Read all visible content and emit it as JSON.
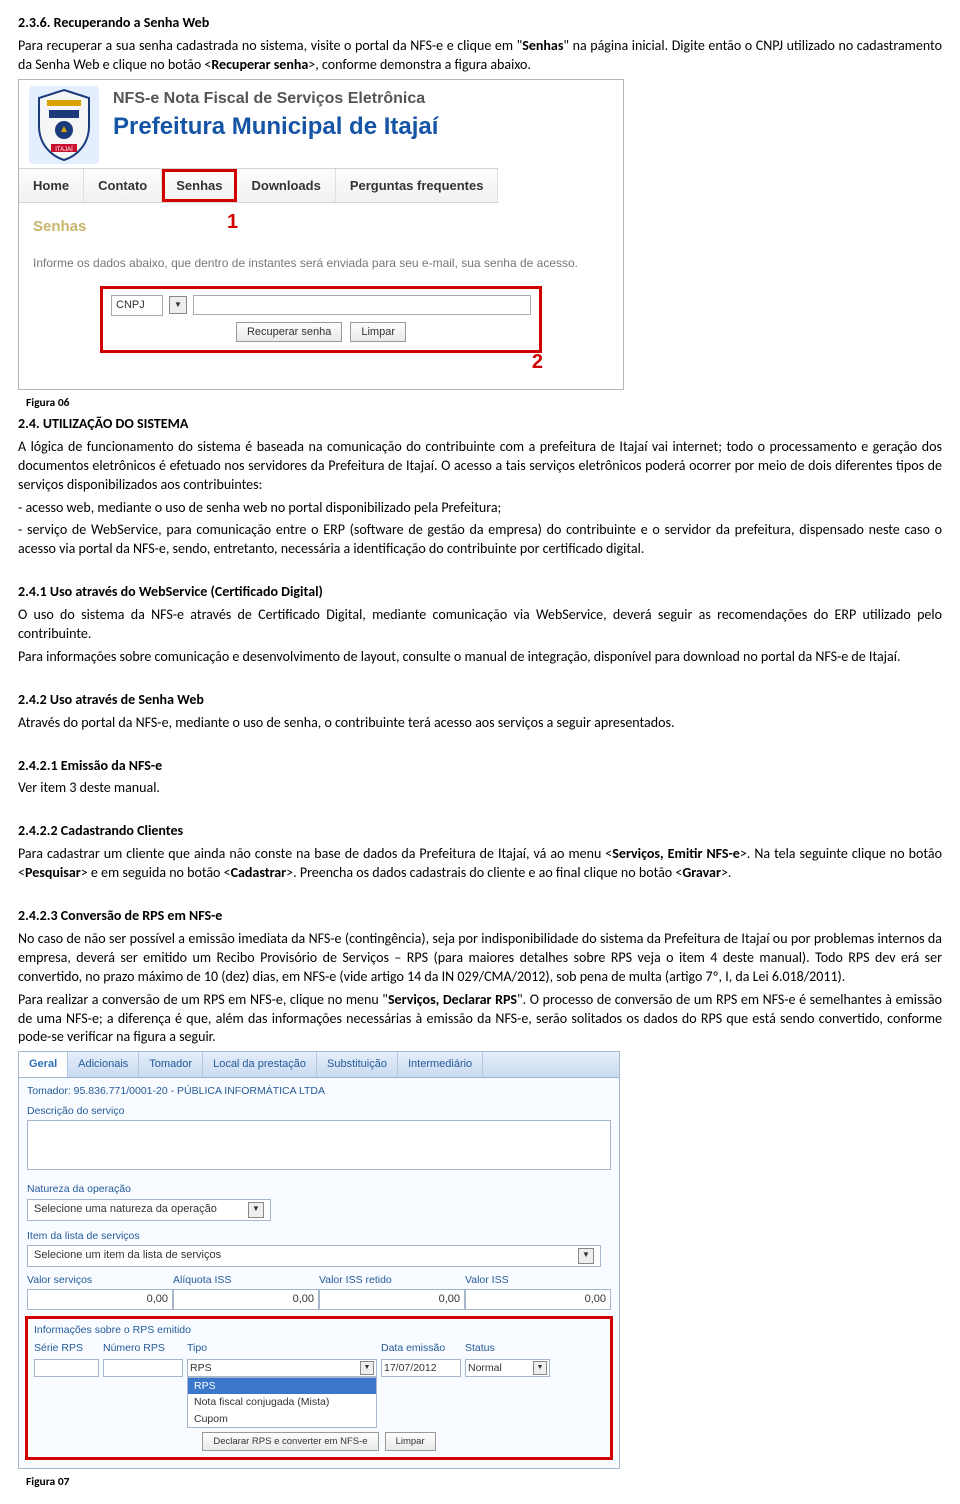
{
  "sec236": {
    "num": "2.3.6. ",
    "title": "Recuperando a Senha Web",
    "p1a": "Para recuperar a sua senha cadastrada no sistema, visite o portal da NFS-e e clique em \"",
    "p1b": "Senhas",
    "p1c": "\" na página inicial. Digite então o CNPJ utilizado no cadastramento da Senha Web e clique no botão <",
    "p1d": "Recuperar senha",
    "p1e": ">, conforme demonstra a figura abaixo."
  },
  "shot1": {
    "sys_name": "NFS-e Nota Fiscal de Serviços Eletrônica",
    "pref_name": "Prefeitura Municipal de Itajaí",
    "nav": [
      "Home",
      "Contato",
      "Senhas",
      "Downloads",
      "Perguntas frequentes"
    ],
    "step1": "1",
    "bread": "Senhas",
    "info": "Informe os dados abaixo, que dentro de instantes será enviada para seu e-mail, sua senha de acesso.",
    "cnpj": "CNPJ",
    "btn_recover": "Recuperar senha",
    "btn_clear": "Limpar",
    "step2": "2"
  },
  "fig06": "Figura 06",
  "sec24": {
    "num": "2.4. ",
    "title_sc": "UTILIZAÇÃO DO SISTEMA",
    "body": "A lógica de funcionamento do sistema é baseada na comunicação do contribuinte com a prefeitura de Itajaí vai internet; todo o processamento e geração dos documentos eletrônicos é efetuado nos servidores da Prefeitura de Itajaí. O acesso a tais serviços eletrônicos poderá ocorrer por meio de dois diferentes tipos de serviços disponibilizados aos contribuintes:",
    "b1": "- acesso web, mediante o uso de senha web no portal disponibilizado pela Prefeitura;",
    "b2": "- serviço de WebService, para comunicação entre o ERP (software de gestão da empresa) do contribuinte e o servidor da prefeitura, dispensado neste caso o acesso via portal da NFS-e, sendo, entretanto, necessária a identificação do contribuinte por certificado digital."
  },
  "sec241": {
    "title": "2.4.1 Uso através do WebService (Certificado Digital)",
    "p1": "O uso do sistema da NFS-e através de Certificado Digital, mediante comunicação via WebService, deverá seguir as recomendações do ERP utilizado pelo contribuinte.",
    "p2": "Para informações sobre comunicação e desenvolvimento de layout, consulte o manual de integração, disponível para download no portal da NFS-e de Itajaí."
  },
  "sec242": {
    "title": "2.4.2 Uso através de Senha Web",
    "p1": "Através do portal da NFS-e, mediante o uso de senha, o contribuinte terá acesso aos serviços a seguir apresentados."
  },
  "sec2421": {
    "title": "2.4.2.1 Emissão da NFS-e",
    "p1": "Ver item 3 deste manual."
  },
  "sec2422": {
    "title": "2.4.2.2 Cadastrando Clientes",
    "p1a": "Para cadastrar um cliente que ainda não conste na base de dados da Prefeitura de Itajaí, vá ao menu <",
    "p1b": "Serviços, Emitir NFS-e",
    "p1c": ">. Na tela seguinte clique no botão <",
    "p1d": "Pesquisar",
    "p1e": "> e em seguida no botão <",
    "p1f": "Cadastrar",
    "p1g": ">. Preencha os dados cadastrais do cliente e ao final clique no botão <",
    "p1h": "Gravar",
    "p1i": ">."
  },
  "sec2423": {
    "title": "2.4.2.3 Conversão de RPS em NFS-e",
    "p1a": "No caso de não ser possível a emissão imediata da NFS-e (contingência), seja por indisponibilidade do sistema da Prefeitura de Itajaí ou por problemas internos da empresa, deverá ser emitido um Recibo Provisório de Serviços – RPS (para maiores detalhes sobre RPS veja o item 4 deste manual). Todo RPS dev           erá ser convertido, no prazo máximo de 10 (dez) dias, em NFS-e (vide artigo 14 da IN 029/CMA/2012), sob pena de multa (artigo 7º, I, da Lei 6.018/2011).",
    "p2a": "Para realizar a conversão de um RPS em NFS-e, clique no menu \"",
    "p2b": "Serviços, Declarar RPS",
    "p2c": "\". O processo de conversão de um RPS em NFS-e é semelhantes à emissão de uma NFS-e; a diferença é que, além das informações necessárias à emissão da NFS-e, serão solitados os dados do RPS que está sendo convertido, conforme pode-se verificar na figura a seguir."
  },
  "shot2": {
    "tabs": [
      "Geral",
      "Adicionais",
      "Tomador",
      "Local da prestação",
      "Substituição",
      "Intermediário"
    ],
    "tomador": "Tomador: 95.836.771/0001-20 - PÚBLICA INFORMÁTICA LTDA",
    "descricao": "Descrição do serviço",
    "natureza_lbl": "Natureza da operação",
    "natureza_sel": "Selecione uma natureza da operação",
    "item_lbl": "Item da lista de serviços",
    "item_sel": "Selecione um item da lista de serviços",
    "valores": {
      "vs_lbl": "Valor serviços",
      "vs": "0,00",
      "aliq_lbl": "Alíquota ISS",
      "aliq": "0,00",
      "ret_lbl": "Valor ISS retido",
      "ret": "0,00",
      "iss_lbl": "Valor ISS",
      "iss": "0,00"
    },
    "rpsbox": {
      "title": "Informações sobre o RPS emitido",
      "h": [
        "Série RPS",
        "Número RPS",
        "Tipo",
        "Data emissão",
        "Status"
      ],
      "tipo_sel": "RPS",
      "data": "17/07/2012",
      "status": "Normal",
      "opts": [
        "RPS",
        "Nota fiscal conjugada (Mista)",
        "Cupom"
      ],
      "btn_declare": "Declarar RPS e converter em NFS-e",
      "btn_clear": "Limpar"
    }
  },
  "fig07": "Figura 07"
}
